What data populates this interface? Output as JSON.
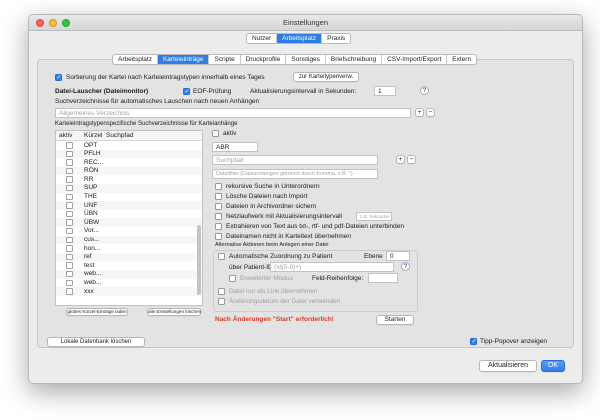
{
  "window": {
    "title": "Einstellungen"
  },
  "top_tabs": [
    "Nutzer",
    "Arbeitsplatz",
    "Praxis"
  ],
  "top_tab_selected": 1,
  "sub_tabs": [
    "Arbeitsplatz",
    "Karteieinträge",
    "Scripte",
    "Druckprofile",
    "Sonstiges",
    "Briefschreibung",
    "CSV-Import/Export",
    "Extern"
  ],
  "sub_tab_selected": 1,
  "sort": {
    "label": "Sortierung der Kartei nach Karteieintragstypen innerhalb eines Tages",
    "checked": true,
    "button": "zur Karteitypenverw."
  },
  "watcher": {
    "title": "Datei-Lauscher (Dateimonitor)",
    "eof_label": "EOF-Prüfung",
    "eof_checked": true,
    "interval_label": "Aktualisierungsintervall in Sekunden:",
    "interval_value": "1",
    "help": "?",
    "dirs_label": "Suchverzeichnisse für automatisches Lauschen nach neuen Anhängen",
    "dirs_placeholder": "Allgemeines Verzeichnis",
    "plus": "+",
    "minus": "−"
  },
  "type_dirs": {
    "label": "Karteieintragstypenspezifische Suchverzeichnisse für Karteianhänge",
    "columns": [
      "aktiv",
      "Kürzel",
      "Suchpfad"
    ],
    "rows": [
      "OPT",
      "PFLH",
      "REC...",
      "RÖN",
      "RR",
      "SUP",
      "THE",
      "UNF",
      "ÜBN",
      "ÜBW",
      "Vor...",
      "cus...",
      "hon...",
      "ref",
      "test",
      "web...",
      "web...",
      "xxx"
    ],
    "btn_load": "globes Kürzel-Einträge laden",
    "btn_delete": "alle Einstellungen löschen"
  },
  "detail": {
    "aktiv_label": "aktiv",
    "kuerzel_value": "ABR",
    "path_placeholder": "Suchpfad",
    "filter_placeholder": "Dateifilter (Dateiendungen getrennt durch Komma, z.B. *)",
    "opt_recursive": "rekursive Suche in Unterordnern",
    "opt_delete": "Lösche Dateien nach Import",
    "opt_archive": "Dateien in Archivordner sichern",
    "opt_network": "Netzlaufwerk mit Aktualisierungsintervall",
    "network_placeholder": "z.B. Sekunden",
    "opt_extract": "Extrahieren von Text aus txt-, rtf- und pdf-Dateien unterbinden",
    "opt_names": "Dateinamen nicht in Karteitext übernehmen",
    "alt_title": "Alternative Aktionen beim Anlegen einer Datei",
    "auto_assign": "Automatische Zuordnung zu Patient",
    "level_label": "Ebene",
    "level_value": "0",
    "patient_id_label": "über Patient-ID:",
    "patient_id_placeholder": "(\\d{5-9}+)",
    "extended_mode": "Erweiterter Modus",
    "field_order_label": "Feld-Reihenfolge:",
    "link_only": "Datei nur als Link übernehmen",
    "use_mtime": "Änderungsdatum der Datei verwenden",
    "warning": "Nach Änderungen \"Start\" erforderlich!",
    "start_button": "Starten"
  },
  "footer": {
    "local_db": "Lokale Datenbank löschen",
    "tips_label": "Tipp-Popover anzeigen",
    "tips_checked": true,
    "update": "Aktualisieren",
    "ok": "OK"
  },
  "colors": {
    "accent": "#2f7de6",
    "warning": "#d63a2a",
    "traffic_red": "#fe5f57",
    "traffic_yellow": "#febc2e",
    "traffic_green": "#28c840"
  }
}
